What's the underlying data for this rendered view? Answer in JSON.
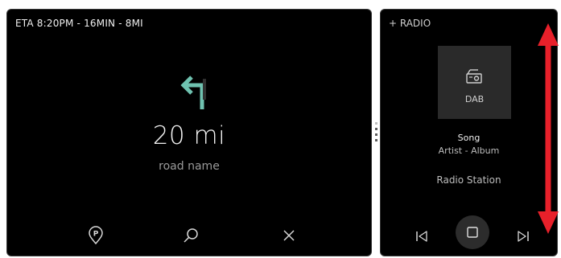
{
  "navigation": {
    "eta": "ETA 8:20PM - 16MIN - 8MI",
    "distance": "20 mi",
    "road_name": "road name",
    "turn_direction": "left",
    "accent_color": "#6fc2b0",
    "buttons": [
      {
        "icon": "parking-icon"
      },
      {
        "icon": "search-icon"
      },
      {
        "icon": "close-icon"
      }
    ]
  },
  "media": {
    "title": "+ RADIO",
    "album_label": "DAB",
    "song": "Song",
    "artist_album": "Artist - Album",
    "station": "Radio Station",
    "controls": [
      {
        "icon": "skip-previous-icon"
      },
      {
        "icon": "stop-icon"
      },
      {
        "icon": "skip-next-icon"
      }
    ]
  },
  "colors": {
    "panel_bg": "#000000",
    "album_bg": "#2a2a2a",
    "arrow_red": "#e8202a"
  }
}
